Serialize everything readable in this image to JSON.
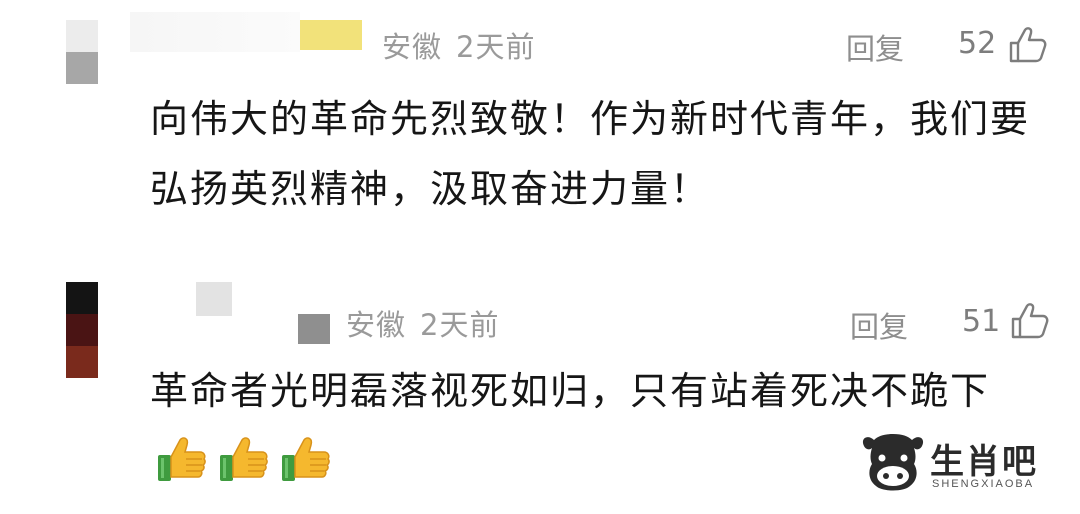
{
  "comments": [
    {
      "location": "安徽",
      "time": "2天前",
      "reply_label": "回复",
      "likes": "52",
      "text": "向伟大的革命先烈致敬！作为新时代青年，我们要弘扬英烈精神，汲取奋进力量！"
    },
    {
      "location": "安徽",
      "time": "2天前",
      "reply_label": "回复",
      "likes": "51",
      "text": "革命者光明磊落视死如归，只有站着死决不跪下"
    }
  ],
  "watermark": {
    "name": "生肖吧",
    "sub": "SHENGXIAOBA"
  },
  "colors": {
    "meta": "#9a9a9a",
    "text": "#161616",
    "emoji_yellow": "#f5b82e",
    "emoji_green": "#3f9b3f"
  },
  "icons": [
    "thumbs-up-outline-icon",
    "thumbs-up-emoji-icon",
    "ox-logo-icon"
  ]
}
